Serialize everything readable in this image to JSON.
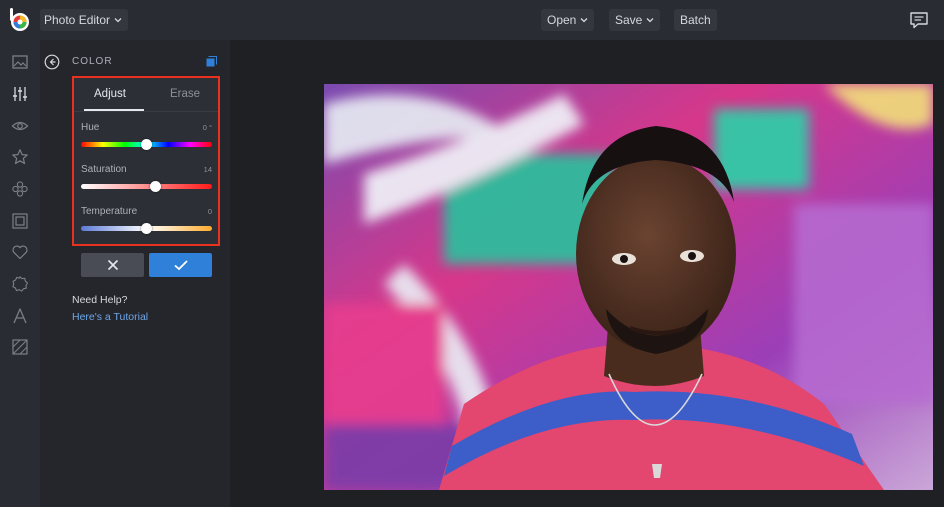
{
  "topbar": {
    "app_name": "Photo Editor",
    "open_label": "Open",
    "save_label": "Save",
    "batch_label": "Batch"
  },
  "panel": {
    "title": "COLOR",
    "tabs": [
      {
        "label": "Adjust",
        "active": true
      },
      {
        "label": "Erase",
        "active": false
      }
    ],
    "sliders": [
      {
        "label": "Hue",
        "value_text": "0 °",
        "level": 0.5
      },
      {
        "label": "Saturation",
        "value_text": "14",
        "level": 0.57
      },
      {
        "label": "Temperature",
        "value_text": "0",
        "level": 0.5
      }
    ],
    "help_title": "Need Help?",
    "help_link": "Here's a Tutorial"
  },
  "rail_icons": [
    "image-icon",
    "sliders-icon",
    "eye-icon",
    "star-icon",
    "flower-icon",
    "frame-icon",
    "heart-icon",
    "badge-icon",
    "text-icon",
    "texture-icon"
  ],
  "colors": {
    "accent": "#2f80d8",
    "highlight_border": "#e8321d",
    "panel_bg": "#24262c",
    "topbar_bg": "#2a2c33"
  }
}
